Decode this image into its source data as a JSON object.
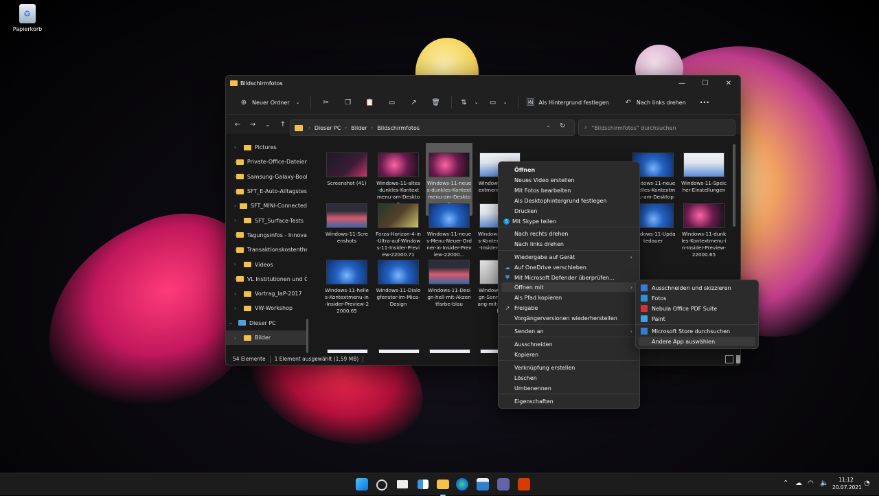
{
  "desktop": {
    "recycle_bin_label": "Papierkorb"
  },
  "window": {
    "title": "Bildschirmfotos",
    "controls": {
      "minimize": "—",
      "maximize": "☐",
      "close": "✕"
    }
  },
  "toolbar": {
    "new_folder": "Neuer Ordner",
    "set_background": "Als Hintergrund festlegen",
    "rotate_left": "Nach links drehen",
    "more": "•••"
  },
  "address": {
    "crumbs": [
      "Dieser PC",
      "Bilder",
      "Bildschirmfotos"
    ],
    "search_placeholder": "\"Bildschirmfotos\" durchsuchen"
  },
  "sidebar": {
    "items": [
      {
        "label": "Pictures"
      },
      {
        "label": "Private-Office-Dateien"
      },
      {
        "label": "Samsung-Galaxy-Book"
      },
      {
        "label": "SFT_E-Auto-Alltagstest"
      },
      {
        "label": "SFT_MINI-Connected"
      },
      {
        "label": "SFT_Surface-Tests"
      },
      {
        "label": "Tagungsinfos - Innovation"
      },
      {
        "label": "Transaktionskostentheorie"
      },
      {
        "label": "Videos"
      },
      {
        "label": "VL Institutionen und Ö"
      },
      {
        "label": "Vortrag_IaP-2017"
      },
      {
        "label": "VW-Workshop"
      },
      {
        "label": "Dieser PC"
      },
      {
        "label": "Bilder"
      }
    ]
  },
  "files": [
    {
      "name": "Screenshot (41)",
      "thumb": "th-dark"
    },
    {
      "name": "Windows-11-altes-dunkles-Kontextmenu-am-Desktop",
      "thumb": "th-pink"
    },
    {
      "name": "Windows-11-neues-dunkles-Kontextmenu-am-Desktop",
      "thumb": "th-pink"
    },
    {
      "name": "Windows-11-Kontextmenu-Dateien",
      "thumb": "th-light"
    },
    {
      "name": "Windows-11-neues-helles-Kontextmenu-am-Desktop",
      "thumb": "th-blue"
    },
    {
      "name": "Windows-11-Speicher-Einstellungen",
      "thumb": "th-light"
    },
    {
      "name": "Windows-11-Screenshots",
      "thumb": "th-web"
    },
    {
      "name": "Forza-Horizon-4-in-Ultra-auf-Windows-11-Insider-Preview-22000.71",
      "thumb": "th-game"
    },
    {
      "name": "Windows-11-neues-Menu-Neuer-Ordner-in-Insider-Preview-22000...",
      "thumb": "th-blue"
    },
    {
      "name": "Windows-11-neues-Kontextmenu-in-Insider-w-22000",
      "thumb": "th-light"
    },
    {
      "name": "Windows-11-Updatedauer",
      "thumb": "th-blue"
    },
    {
      "name": "Windows-11-dunkles-Kontextmenu-in-Insider-Preview-22000.65",
      "thumb": "th-pink"
    },
    {
      "name": "Windows-11-helles-Kontextmenu-in-Insider-Preview-22000.65",
      "thumb": "th-blue"
    },
    {
      "name": "Windows-11-Dialogfenster-im-Mica-Design",
      "thumb": "th-blue"
    },
    {
      "name": "Windows-11-Design-hell-mit-Akzentfarbe-blau",
      "thumb": "th-web"
    },
    {
      "name": "Windows-11-Design-Sonnenuntergang-mit-Akzentfarbe",
      "thumb": "th-grey"
    }
  ],
  "status": {
    "count": "54 Elemente",
    "selection": "1 Element ausgewählt (1,59 MB)"
  },
  "context_menu": {
    "items": [
      {
        "label": "Öffnen",
        "icon": ""
      },
      {
        "label": "Neues Video erstellen",
        "icon": ""
      },
      {
        "label": "Mit Fotos bearbeiten",
        "icon": ""
      },
      {
        "label": "Als Desktophintergrund festlegen",
        "icon": ""
      },
      {
        "label": "Drucken",
        "icon": ""
      },
      {
        "label": "Mit Skype teilen",
        "icon": "skype-icon"
      },
      {
        "label": "Nach rechts drehen",
        "icon": ""
      },
      {
        "label": "Nach links drehen",
        "icon": ""
      },
      {
        "label": "Wiedergabe auf Gerät",
        "icon": ""
      },
      {
        "label": "Auf OneDrive verschieben",
        "icon": "onedrive-icon"
      },
      {
        "label": "Mit Microsoft Defender überprüfen...",
        "icon": "defender-icon"
      },
      {
        "label": "Öffnen mit",
        "icon": ""
      },
      {
        "label": "Als Pfad kopieren",
        "icon": ""
      },
      {
        "label": "Freigabe",
        "icon": "share-icon"
      },
      {
        "label": "Vorgängerversionen wiederherstellen",
        "icon": ""
      },
      {
        "label": "Senden an",
        "icon": ""
      },
      {
        "label": "Ausschneiden",
        "icon": ""
      },
      {
        "label": "Kopieren",
        "icon": ""
      },
      {
        "label": "Verknüpfung erstellen",
        "icon": ""
      },
      {
        "label": "Löschen",
        "icon": ""
      },
      {
        "label": "Umbenennen",
        "icon": ""
      },
      {
        "label": "Eigenschaften",
        "icon": ""
      }
    ]
  },
  "open_with_submenu": {
    "items": [
      {
        "label": "Ausschneiden und skizzieren",
        "color": "#3a78d8"
      },
      {
        "label": "Fotos",
        "color": "#2f8fd9"
      },
      {
        "label": "Nebula Office PDF Suite",
        "color": "#d13438"
      },
      {
        "label": "Paint",
        "color": "#3fa0e6"
      },
      {
        "label": "Microsoft Store durchsuchen",
        "color": "#2f7fd0"
      },
      {
        "label": "Andere App auswählen",
        "color": ""
      }
    ]
  },
  "taskbar": {
    "time": "11:12",
    "date": "20.07.2021"
  }
}
